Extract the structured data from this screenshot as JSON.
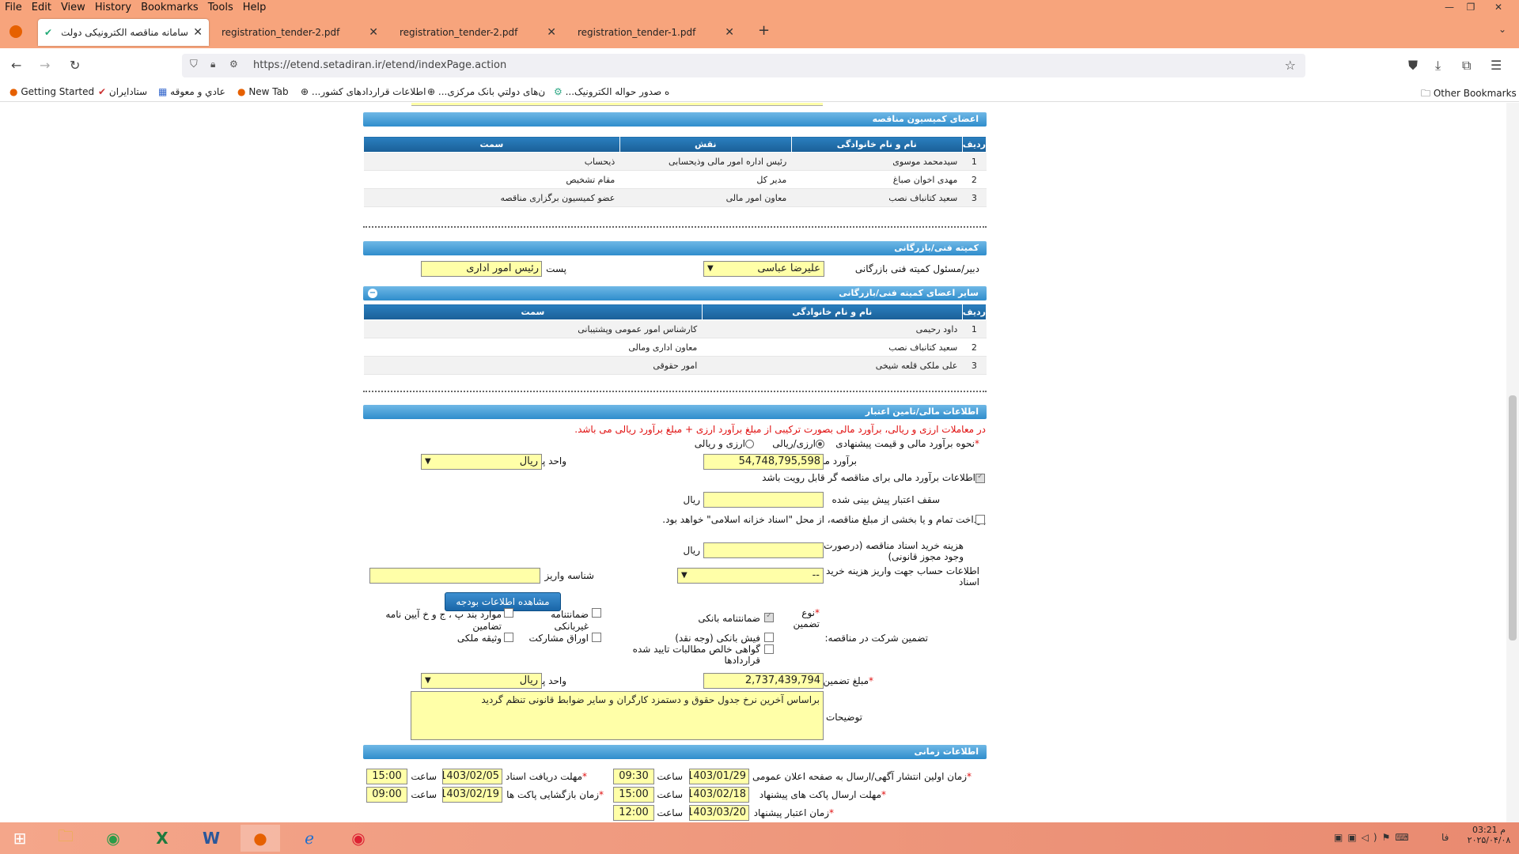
{
  "browser": {
    "menu": [
      "File",
      "Edit",
      "View",
      "History",
      "Bookmarks",
      "Tools",
      "Help"
    ],
    "tabs": [
      {
        "title": "سامانه مناقصه الکترونیکی دولت",
        "active": true
      },
      {
        "title": "registration_tender-2.pdf",
        "active": false
      },
      {
        "title": "registration_tender-2.pdf",
        "active": false
      },
      {
        "title": "registration_tender-1.pdf",
        "active": false
      }
    ],
    "url": "https://etend.setadiran.ir/etend/indexPage.action",
    "bookmarks": [
      "Getting Started",
      "ستادایران",
      "عادي و معوقه",
      "New Tab",
      "...اطلاعات قراردادهای کشور",
      "...ن‌های دولتي بانک مرکزی",
      "...ه صدور حواله الکترونیک"
    ],
    "other_bookmarks": "Other Bookmarks"
  },
  "commission": {
    "header": "اعضای کمیسیون مناقصه",
    "columns": [
      "ردیف",
      "نام و نام خانوادگی",
      "نقش",
      "سمت"
    ],
    "rows": [
      [
        "1",
        "سیدمحمد موسوی",
        "رئیس اداره امور مالی وذیحسابی",
        "ذیحساب"
      ],
      [
        "2",
        "مهدی اخوان صباغ",
        "مدیر کل",
        "مقام تشخیص"
      ],
      [
        "3",
        "سعید کتانباف نصب",
        "معاون امور مالی",
        "عضو کمیسیون برگزاری مناقصه"
      ]
    ]
  },
  "technical": {
    "header": "کمیته فنی/بازرگانی",
    "secretary_label": "دبیر/مسئول کمیته فنی بازرگانی",
    "secretary_value": "علیرضا عباسی",
    "post_label": "پست",
    "post_value": "رئیس امور اداری",
    "others_header": "سایر اعضای کمیته فنی/بازرگانی",
    "columns": [
      "ردیف",
      "نام و نام خانوادگی",
      "سمت"
    ],
    "rows": [
      [
        "1",
        "داود رحیمی",
        "کارشناس امور عمومی وپشتیبانی"
      ],
      [
        "2",
        "سعید کتانباف نصب",
        "معاون اداری ومالی"
      ],
      [
        "3",
        "علی ملکی قلعه شیخی",
        "امور حقوقی"
      ]
    ]
  },
  "financial": {
    "header": "اطلاعات مالی/تامین اعتبار",
    "note": "در معاملات ارزی و ریالی، برآورد مالی بصورت ترکیبی از مبلغ برآورد ارزی + مبلغ برآورد ریالی می باشد.",
    "method_label": "نحوه برآورد مالی و قیمت پیشنهادی",
    "radio1": "ارزی/ریالی",
    "radio2": "ارزی و ریالی",
    "estimate_label": "برآورد مالی",
    "estimate_value": "54,748,795,598",
    "currency_label": "واحد پول",
    "currency_value": "ریال",
    "visible_label": "اطلاعات برآورد مالی برای مناقصه گر قابل رویت باشد",
    "credit_label": "سقف اعتبار پیش بینی شده",
    "rial": "ریال",
    "budget_button": "مشاهده اطلاعات بودجه",
    "treasury_label": "پرداخت تمام و یا بخشی از مبلغ مناقصه، از محل \"اسناد خزانه اسلامی\" خواهد بود.",
    "doc_cost_label": "هزینه خرید اسناد مناقصه (درصورت وجود مجوز قانونی)",
    "account_label": "اطلاعات حساب جهت واریز هزینه خرید اسناد",
    "account_value": "--",
    "deposit_id_label": "شناسه واریز",
    "guarantee_label": "تضمین شرکت در مناقصه:",
    "guarantee_type_label": "نوع تضمین",
    "g_bank": "ضمانتنامه بانکی",
    "g_cash": "فیش بانکی (وجه نقد)",
    "g_cert": "گواهی خالص مطالبات تایید شده قراردادها",
    "g_nonbank": "ضمانتنامه غیربانکی",
    "g_bonds": "اوراق مشارکت",
    "g_items": "موارد بند پ ، ج و خ آیین نامه تضامین",
    "g_property": "وثیقه ملکی",
    "amount_label": "مبلغ تضمین",
    "amount_value": "2,737,439,794",
    "desc_label": "توضیحات",
    "desc_value": "براساس آخرین نرخ جدول حقوق و دستمزد کارگران و سایر ضوابط قانونی تنظم گردید"
  },
  "timing": {
    "header": "اطلاعات زمانی",
    "publish_label": "زمان اولین انتشار آگهی/ارسال به صفحه اعلان عمومی",
    "publish_date": "1403/01/29",
    "publish_time": "09:30",
    "receive_label": "مهلت دریافت اسناد",
    "receive_date": "1403/02/05",
    "receive_time": "15:00",
    "send_label": "مهلت ارسال پاکت های پیشنهاد",
    "send_date": "1403/02/18",
    "send_time": "15:00",
    "open_label": "زمان بازگشایی پاکت ها",
    "open_date": "1403/02/19",
    "open_time": "09:00",
    "validity_label": "زمان اعتبار پیشنهاد",
    "validity_date": "1403/03/20",
    "validity_time": "12:00",
    "hour": "ساعت"
  },
  "taskbar": {
    "time": "03:21 م",
    "date": "۲۰۲۵/۰۴/۰۸",
    "lang": "فا"
  }
}
